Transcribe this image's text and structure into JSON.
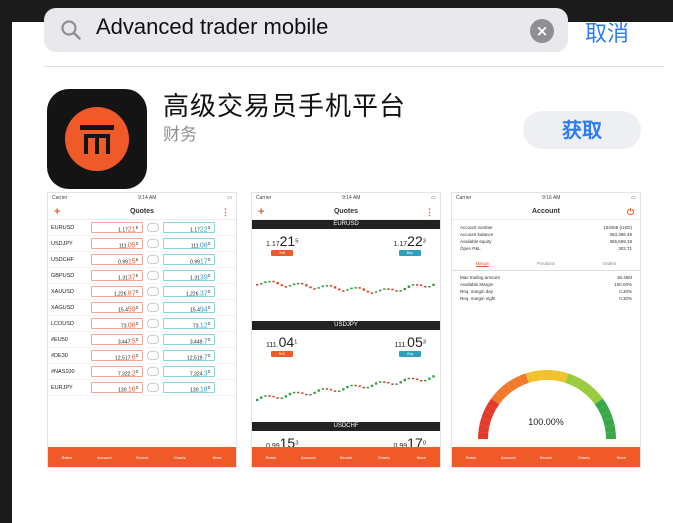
{
  "search": {
    "query": "Advanced trader mobile",
    "cancel_label": "取消"
  },
  "app": {
    "name": "高级交易员手机平台",
    "category": "财务",
    "get_label": "获取"
  },
  "colors": {
    "accent": "#2b7cf6",
    "brand": "#f05a28"
  },
  "screens": {
    "quotes": {
      "status_left": "Carrier",
      "status_time": "9:14 AM",
      "title": "Quotes",
      "rows": [
        {
          "symbol": "EURUSD",
          "bid_pre": "1.17",
          "bid_big": "21",
          "bid_sup": "5",
          "ask_pre": "1.17",
          "ask_big": "22",
          "ask_sup": "3"
        },
        {
          "symbol": "USDJPY",
          "bid_pre": "111.",
          "bid_big": "05",
          "bid_sup": "0",
          "ask_pre": "111.",
          "ask_big": "06",
          "ask_sup": "0"
        },
        {
          "symbol": "USDCHF",
          "bid_pre": "0.99",
          "bid_big": "15",
          "bid_sup": "6",
          "ask_pre": "0.99",
          "ask_big": "17",
          "ask_sup": "0"
        },
        {
          "symbol": "GBPUSD",
          "bid_pre": "1.31",
          "bid_big": "37",
          "bid_sup": "5",
          "ask_pre": "1.31",
          "ask_big": "39",
          "ask_sup": "0"
        },
        {
          "symbol": "XAUUSD",
          "bid_pre": "1,226.",
          "bid_big": "87",
          "bid_sup": "0",
          "ask_pre": "1,226.",
          "ask_big": "37",
          "ask_sup": "0"
        },
        {
          "symbol": "XAGUSD",
          "bid_pre": "15.4",
          "bid_big": "59",
          "bid_sup": "0",
          "ask_pre": "15.4",
          "ask_big": "94",
          "ask_sup": "0"
        },
        {
          "symbol": "LCOUSD",
          "bid_pre": "73.",
          "bid_big": "06",
          "bid_sup": "0",
          "ask_pre": "73.",
          "ask_big": "12",
          "ask_sup": "0"
        },
        {
          "symbol": "#EU50",
          "bid_pre": "3,447.",
          "bid_big": "5",
          "bid_sup": "0",
          "ask_pre": "3,449.",
          "ask_big": "7",
          "ask_sup": "0"
        },
        {
          "symbol": "#DE30",
          "bid_pre": "12,517.",
          "bid_big": "6",
          "bid_sup": "0",
          "ask_pre": "12,519.",
          "ask_big": "7",
          "ask_sup": "0"
        },
        {
          "symbol": "#NAS100",
          "bid_pre": "7,322.",
          "bid_big": "2",
          "bid_sup": "0",
          "ask_pre": "7,324.",
          "ask_big": "3",
          "ask_sup": "0"
        },
        {
          "symbol": "EURJPY",
          "bid_pre": "130.",
          "bid_big": "16",
          "bid_sup": "0",
          "ask_pre": "130.",
          "ask_big": "18",
          "ask_sup": "0"
        }
      ]
    },
    "detail": {
      "status_left": "Carrier",
      "status_time": "9:14 AM",
      "title": "Quotes",
      "pairs": [
        {
          "name": "EURUSD",
          "bid_pre": "1.17",
          "bid_big": "21",
          "bid_sup": "5",
          "ask_pre": "1.17",
          "ask_big": "22",
          "ask_sup": "3",
          "sell": "Sell",
          "buy": "Buy"
        },
        {
          "name": "USDJPY",
          "bid_pre": "111.",
          "bid_big": "04",
          "bid_sup": "1",
          "ask_pre": "111.",
          "ask_big": "05",
          "ask_sup": "3",
          "sell": "Sell",
          "buy": "Buy"
        },
        {
          "name": "USDCHF",
          "bid_pre": "0.99",
          "bid_big": "15",
          "bid_sup": "3",
          "ask_pre": "0.99",
          "ask_big": "17",
          "ask_sup": "0",
          "sell": "Sell",
          "buy": "Buy"
        }
      ]
    },
    "account": {
      "status_left": "Carrier",
      "status_time": "9:16 AM",
      "title": "Account",
      "rows": [
        {
          "label": "Account number",
          "value": "103458 (USD)"
        },
        {
          "label": "Account balance",
          "value": "363,366.48"
        },
        {
          "label": "Available equity",
          "value": "365,669.19"
        },
        {
          "label": "Open P&L",
          "value": "302.71"
        }
      ],
      "tabs": [
        "Margin",
        "Positions",
        "Orders"
      ],
      "margin_rows": [
        {
          "label": "Max trading amount",
          "value": "36.46M"
        },
        {
          "label": "Available Margin",
          "value": "100.00%"
        },
        {
          "label": "Req. margin day",
          "value": "0.30%"
        },
        {
          "label": "Req. margin night",
          "value": "0.30%"
        }
      ],
      "gauge_label": "100.00%",
      "gauge_level": 1.0
    },
    "tabbar": [
      "Rates",
      "Account",
      "Search",
      "Charts",
      "More"
    ]
  }
}
